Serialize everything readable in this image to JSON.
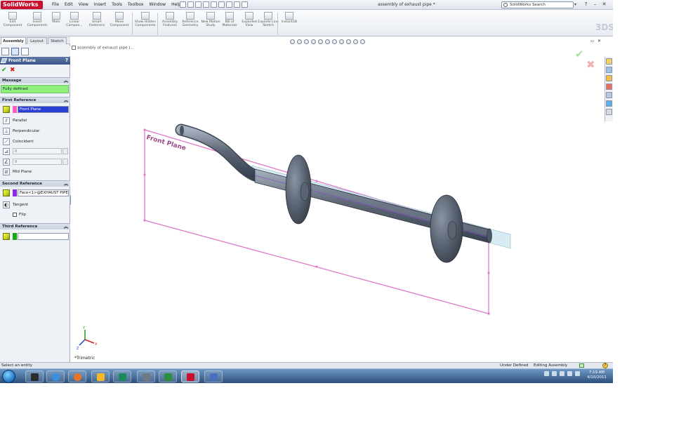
{
  "app": {
    "logo_text": "SolidWorks",
    "document_title": "assembly of exhaust pipe *",
    "menus": [
      "File",
      "Edit",
      "View",
      "Insert",
      "Tools",
      "Toolbox",
      "Window",
      "Help"
    ],
    "search_placeholder": "SolidWorks Search",
    "search_dropdown": "▾",
    "help_glyph": "?",
    "win_min": "–",
    "win_close": "✕"
  },
  "command_manager": {
    "buttons": [
      {
        "label": "Edit Component",
        "icon": "edit-component-icon"
      },
      {
        "label": "Insert Components",
        "icon": "insert-components-icon"
      },
      {
        "label": "Mate",
        "icon": "mate-icon"
      },
      {
        "label": "Linear Compon...",
        "icon": "linear-pattern-icon"
      },
      {
        "label": "Smart Fasteners",
        "icon": "smart-fasteners-icon"
      },
      {
        "label": "Move Component",
        "icon": "move-component-icon"
      },
      {
        "label": "Show Hidden Components",
        "icon": "show-hidden-icon"
      },
      {
        "label": "Assembly Features",
        "icon": "assembly-features-icon"
      },
      {
        "label": "Reference Geometry",
        "icon": "reference-geometry-icon"
      },
      {
        "label": "New Motion Study",
        "icon": "motion-study-icon"
      },
      {
        "label": "Bill of Materials",
        "icon": "bom-icon"
      },
      {
        "label": "Exploded View",
        "icon": "exploded-view-icon"
      },
      {
        "label": "Explode Line Sketch",
        "icon": "explode-line-icon"
      },
      {
        "label": "Instant3D",
        "icon": "instant3d-icon"
      }
    ],
    "tabs": [
      "Assembly",
      "Layout",
      "Sketch"
    ]
  },
  "property_manager": {
    "title": "Front Plane",
    "message_header": "Message",
    "message": "Fully defined",
    "first_reference": {
      "header": "First Reference",
      "value": "Front Plane",
      "options": [
        "Parallel",
        "Perpendicular",
        "Coincident"
      ],
      "distance_value": "0",
      "angle_value": "0",
      "mid_plane_label": "Mid Plane"
    },
    "second_reference": {
      "header": "Second Reference",
      "value": "Face<1>@EXHAUST PIPE",
      "tangent_label": "Tangent",
      "flip_label": "Flip"
    },
    "third_reference": {
      "header": "Third Reference",
      "value": ""
    },
    "colors": {
      "header": "#3d5585",
      "message_bg": "#8ef07a",
      "ref1_swatch": "#ff5fbf",
      "ref2_swatch": "#8a2be2",
      "ref3_swatch": "#1aa81a"
    }
  },
  "viewport": {
    "tree_flyout": "assembly of exhaust pipe (...",
    "plane_label": "Front Plane",
    "view_label": "*Trimetric",
    "triad": {
      "x": "X",
      "y": "Y",
      "z": "Z"
    },
    "colors": {
      "plane": "#e07ac8",
      "pipe": "#55606f",
      "flange": "#4b5462"
    }
  },
  "status_bar": {
    "message": "Select an entity",
    "definition": "Under Defined",
    "mode": "Editing Assembly"
  },
  "taskbar": {
    "time": "7:19 AM",
    "date": "4/10/2011"
  }
}
